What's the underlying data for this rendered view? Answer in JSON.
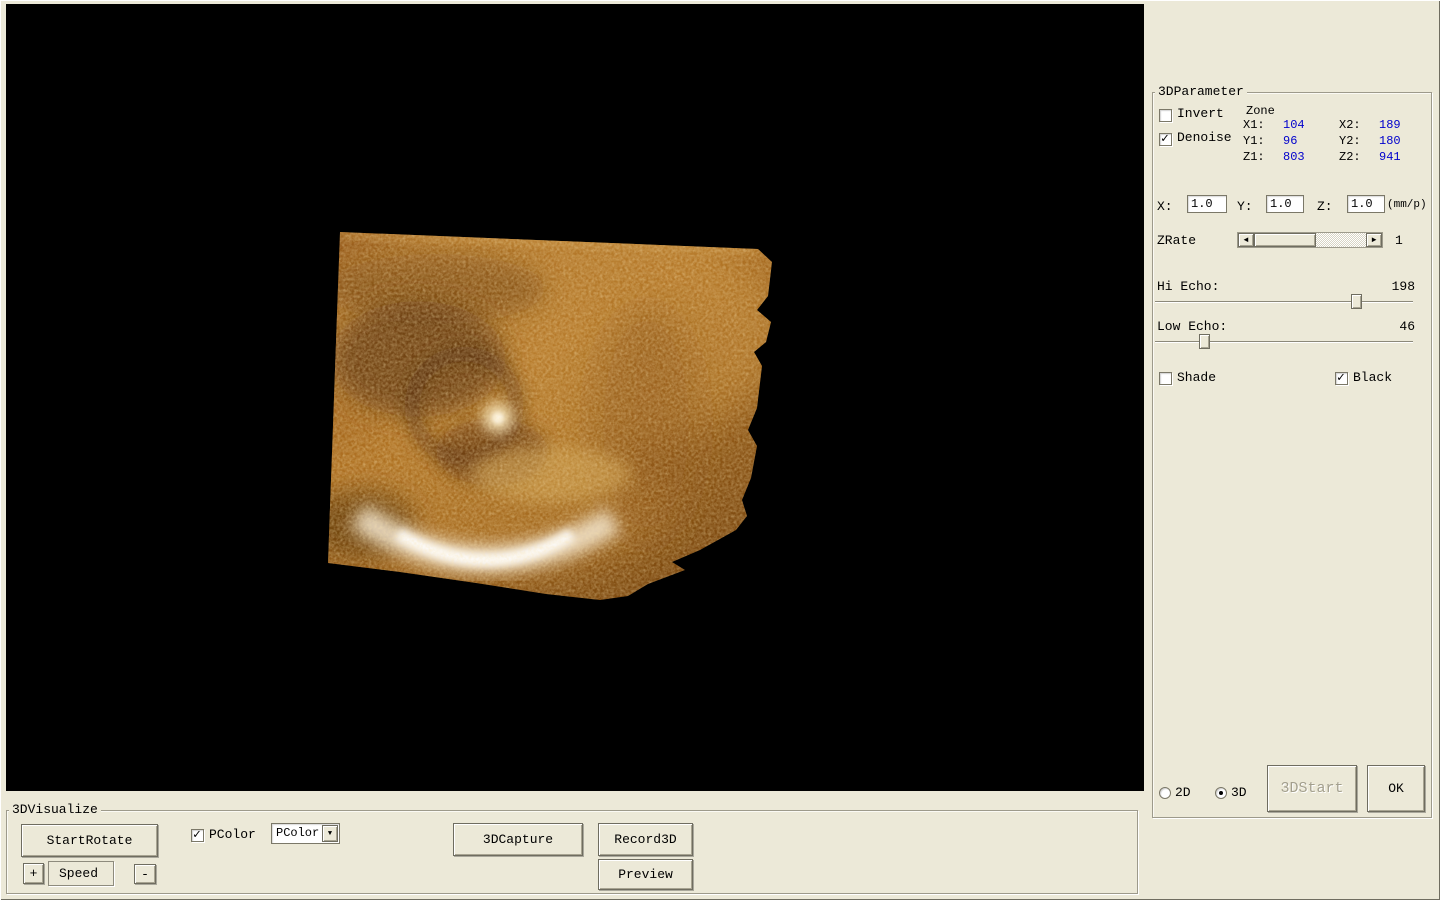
{
  "colors": {
    "panel_bg": "#ece9d8",
    "viewport_bg": "#000000",
    "value_text": "#0000cc",
    "volume_amber": "#a86a1e"
  },
  "parameter_panel": {
    "title": "3DParameter",
    "invert_label": "Invert",
    "invert_checked": false,
    "denoise_label": "Denoise",
    "denoise_checked": true,
    "zone": {
      "title": "Zone",
      "rows": [
        {
          "l1": "X1:",
          "v1": "104",
          "l2": "X2:",
          "v2": "189"
        },
        {
          "l1": "Y1:",
          "v1": "96",
          "l2": "Y2:",
          "v2": "180"
        },
        {
          "l1": "Z1:",
          "v1": "803",
          "l2": "Z2:",
          "v2": "941"
        }
      ]
    },
    "scale": {
      "x_label": "X:",
      "x_value": "1.0",
      "y_label": "Y:",
      "y_value": "1.0",
      "z_label": "Z:",
      "z_value": "1.0",
      "unit": "(mm/p)"
    },
    "zrate": {
      "label": "ZRate",
      "value": "1"
    },
    "hi_echo": {
      "label": "Hi Echo:",
      "value": "198"
    },
    "low_echo": {
      "label": "Low Echo:",
      "value": "46"
    },
    "shade_label": "Shade",
    "shade_checked": false,
    "black_label": "Black",
    "black_checked": true,
    "mode_2d_label": "2D",
    "mode_2d_selected": false,
    "mode_3d_label": "3D",
    "mode_3d_selected": true,
    "start3d_label": "3DStart",
    "ok_label": "OK"
  },
  "visualize_panel": {
    "title": "3DVisualize",
    "start_rotate_label": "StartRotate",
    "pcolor_label": "PColor",
    "pcolor_checked": true,
    "pcolor_select_value": "PColor",
    "capture_label": "3DCapture",
    "record_label": "Record3D",
    "preview_label": "Preview",
    "speed_plus_label": "+",
    "speed_label": "Speed",
    "speed_minus_label": "-"
  }
}
